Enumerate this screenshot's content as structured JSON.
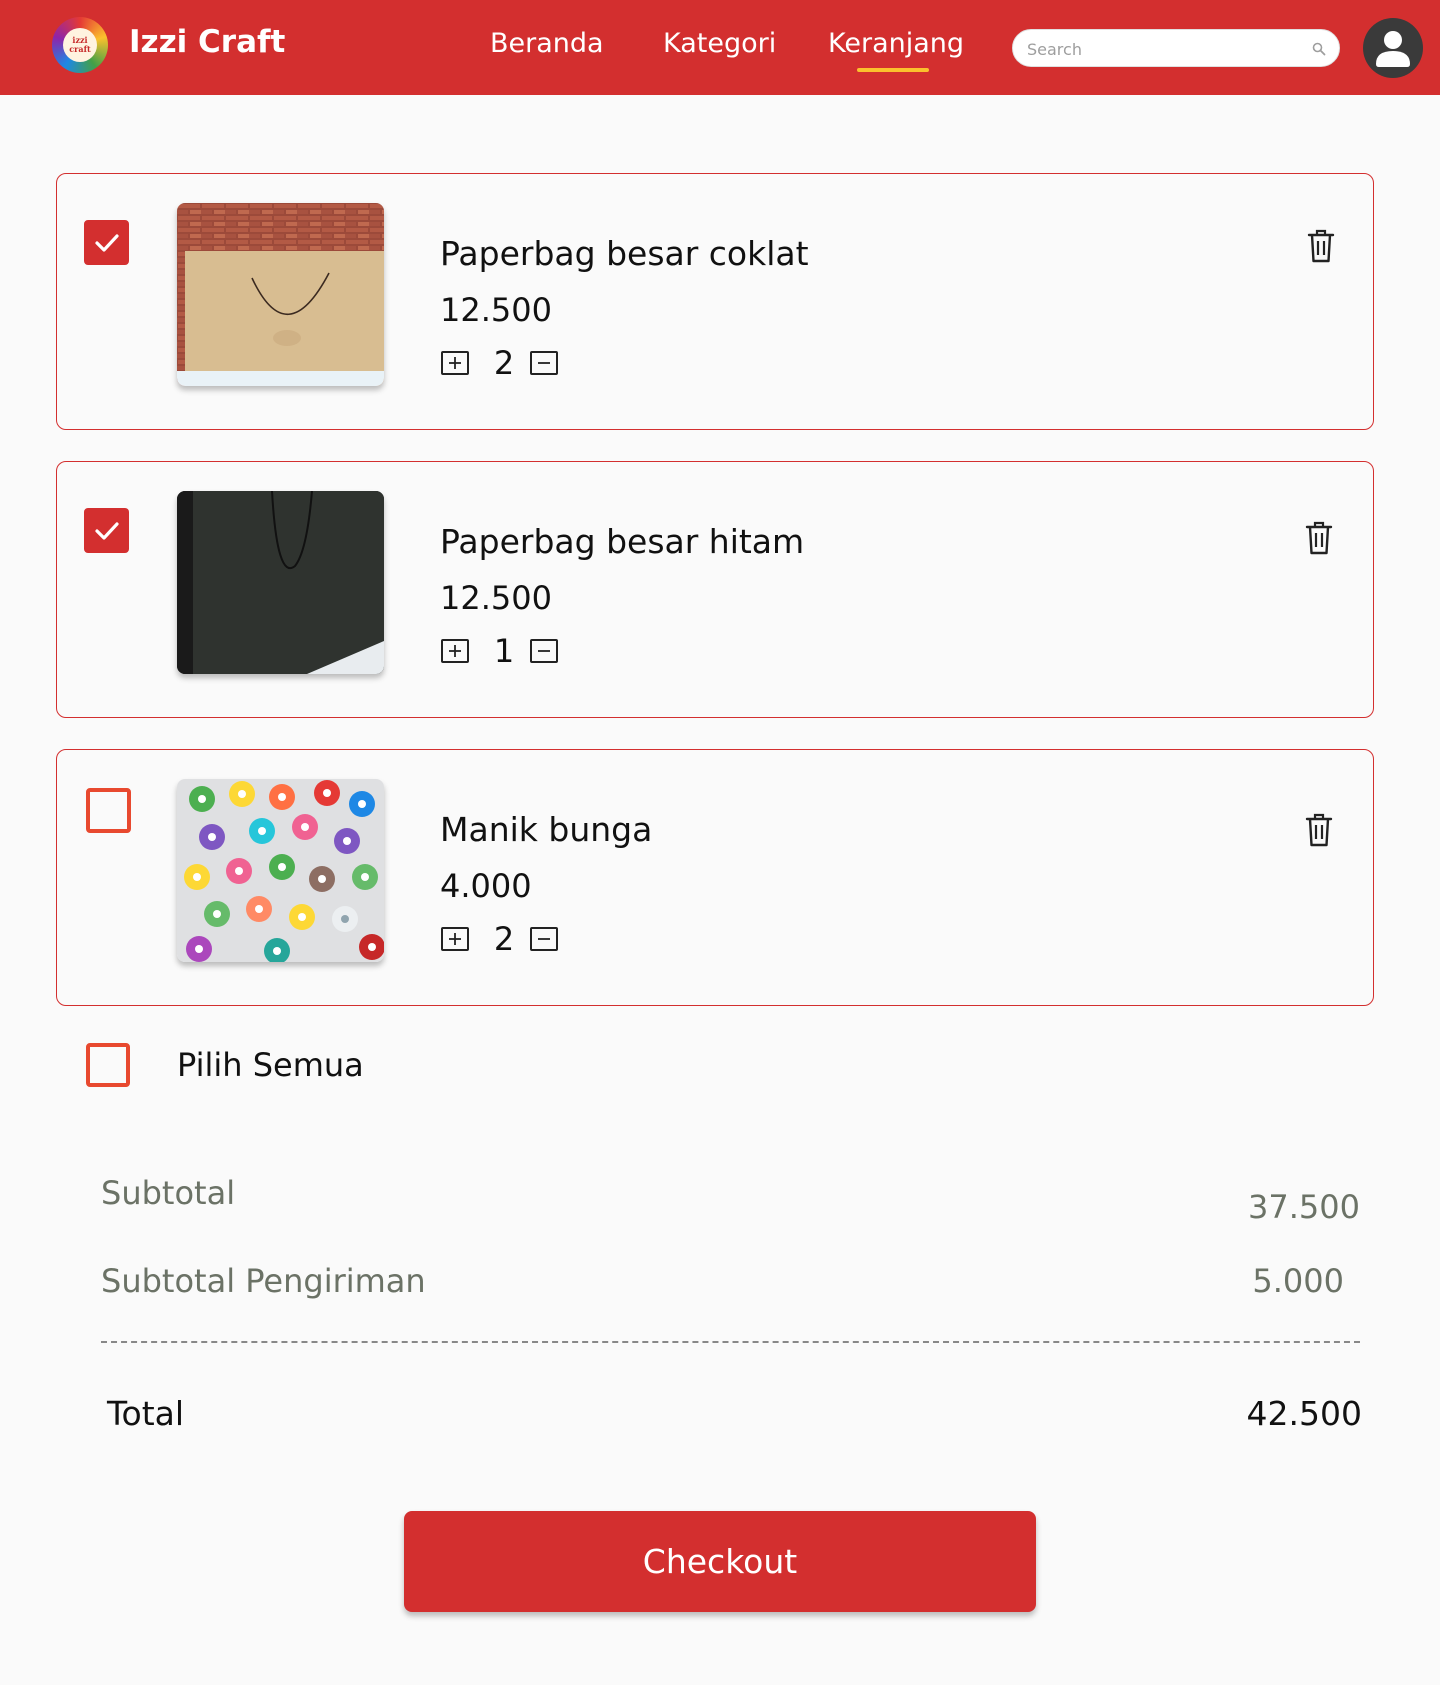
{
  "brand": {
    "name": "Izzi Craft",
    "logo_text": "izzi craft"
  },
  "nav": {
    "links": [
      {
        "label": "Beranda",
        "active": false
      },
      {
        "label": "Kategori",
        "active": false
      },
      {
        "label": "Keranjang",
        "active": true
      }
    ]
  },
  "search": {
    "placeholder": "Search",
    "value": ""
  },
  "icons": {
    "search": "search-icon",
    "avatar": "user-avatar-icon",
    "check": "check-icon",
    "trash": "trash-icon",
    "plus": "plus-icon",
    "minus": "minus-icon"
  },
  "cart": {
    "items": [
      {
        "name": "Paperbag besar coklat",
        "price": "12.500",
        "quantity": "2",
        "checked": true
      },
      {
        "name": "Paperbag besar hitam",
        "price": "12.500",
        "quantity": "1",
        "checked": true
      },
      {
        "name": "Manik bunga",
        "price": "4.000",
        "quantity": "2",
        "checked": false
      }
    ],
    "select_all_label": "Pilih Semua",
    "select_all_checked": false
  },
  "summary": {
    "subtotal_label": "Subtotal",
    "subtotal_value": "37.500",
    "shipping_label": "Subtotal Pengiriman",
    "shipping_value": "5.000",
    "total_label": "Total",
    "total_value": "42.500"
  },
  "checkout_label": "Checkout",
  "colors": {
    "primary": "#d32f2f",
    "accent_underline": "#fbc02d",
    "checkbox_border": "#e8492f",
    "muted_text": "#6b7266"
  }
}
